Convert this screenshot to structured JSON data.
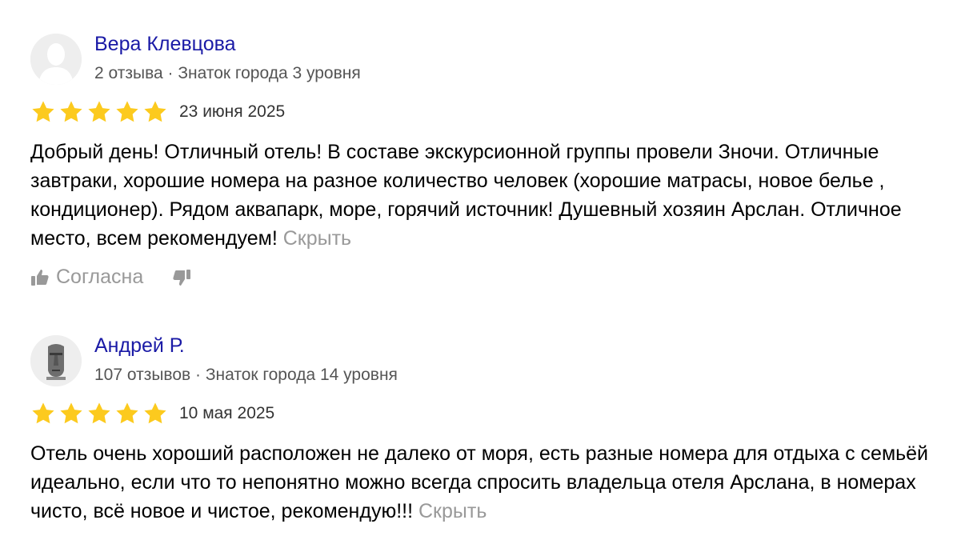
{
  "reviews": [
    {
      "author": "Вера Клевцова",
      "meta": "2 отзыва · Знаток города 3 уровня",
      "rating": 5,
      "date": "23 июня 2025",
      "text": "Добрый день! Отличный отель! В составе экскурсионной группы провели Зночи. Отличные завтраки, хорошие номера на разное количество человек (хорошие матрасы, новое белье , кондиционер). Рядом аквапарк, море, горячий источник! Душевный хозяин Арслан. Отличное место, всем рекомендуем!",
      "hide_label": "Скрыть",
      "agree_label": "Согласна",
      "avatar_icon": "default-user-avatar-icon"
    },
    {
      "author": "Андрей Р.",
      "meta": "107 отзывов · Знаток города 14 уровня",
      "rating": 5,
      "date": "10 мая 2025",
      "text": "Отель очень хороший расположен не далеко от моря, есть разные номера для отдыха с семьёй идеально, если что то непонятно можно всегда спросить владельца отеля Арслана, в номерах чисто, всё новое и чистое, рекомендую!!!",
      "hide_label": "Скрыть",
      "avatar_icon": "moai-statue-avatar-icon"
    }
  ],
  "colors": {
    "author": "#1a1aa6",
    "star": "#fcca1e",
    "muted": "#999999"
  }
}
